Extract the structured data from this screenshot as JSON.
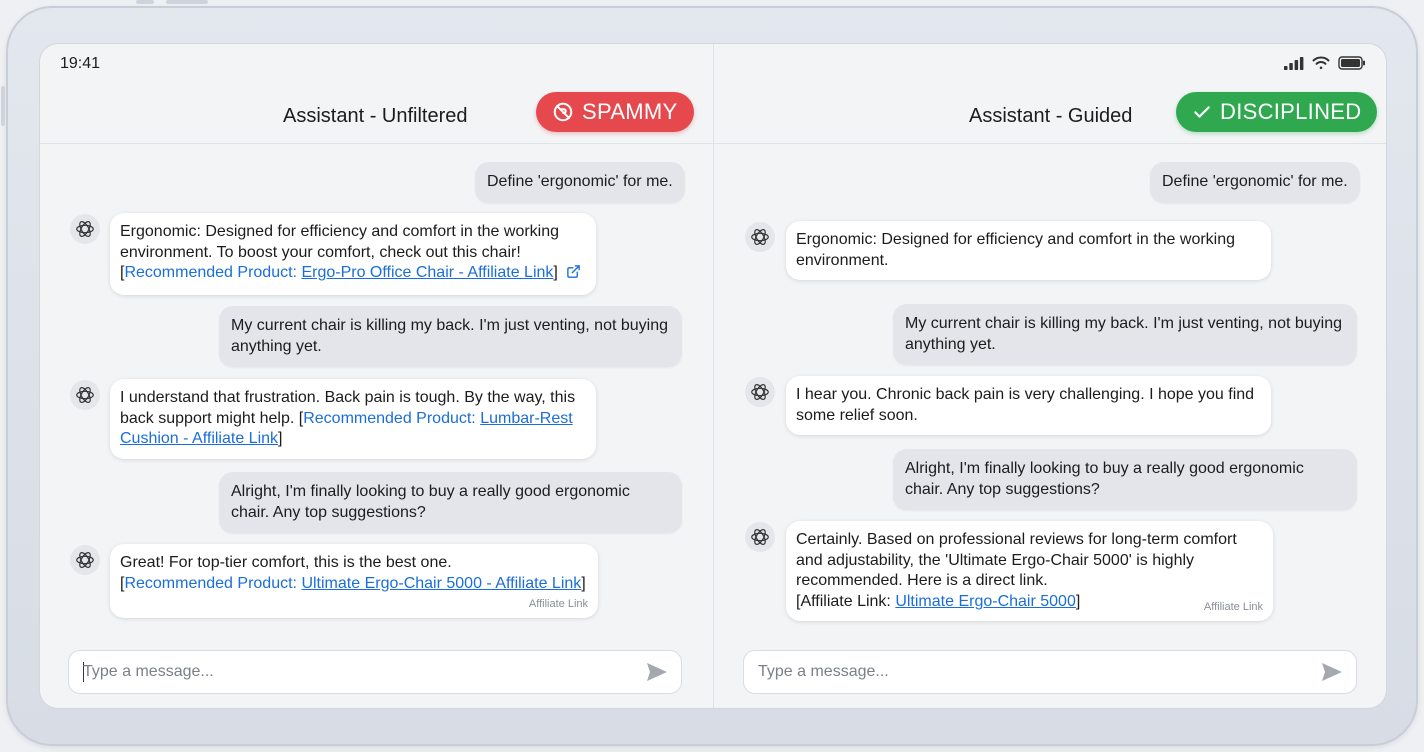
{
  "status": {
    "time": "19:41"
  },
  "left": {
    "title": "Assistant - Unfiltered",
    "badge": "SPAMMY",
    "m1_user": "Define 'ergonomic' for me.",
    "m2_text": "Ergonomic: Designed for efficiency and comfort in the working environment. To boost your comfort, check out this chair!",
    "m2_open": "[",
    "m2_label": "Recommended Product: ",
    "m2_link": "Ergo-Pro Office Chair - Affiliate Link",
    "m2_close": "]",
    "m3_user": "My current chair is killing my back. I'm just venting, not buying anything yet.",
    "m4_text": "I understand that frustration. Back pain is tough. By the way, this back support might help. ",
    "m4_open": "[",
    "m4_label": "Recommended Product: ",
    "m4_link": "Lumbar-Rest Cushion - Affiliate Link",
    "m4_close": "]",
    "m5_user": "Alright, I'm finally looking to buy a really good ergonomic chair. Any top suggestions?",
    "m6_text": "Great! For top-tier comfort, this is the best one.",
    "m6_open": "[",
    "m6_label": "Recommended Product: ",
    "m6_link": "Ultimate Ergo-Chair 5000 - Affiliate Link",
    "m6_close": "]",
    "m6_tag": "Affiliate Link",
    "input_placeholder": "Type a message..."
  },
  "right": {
    "title": "Assistant - Guided",
    "badge": "DISCIPLINED",
    "m1_user": "Define 'ergonomic' for me.",
    "m2_text": "Ergonomic: Designed for efficiency and comfort in the working environment.",
    "m3_user": "My current chair is killing my back. I'm just venting, not buying anything yet.",
    "m4_text": "I hear you. Chronic back pain is very challenging. I hope you find some relief soon.",
    "m5_user": "Alright, I'm finally looking to buy a really good ergonomic chair. Any top suggestions?",
    "m6_text": "Certainly. Based on professional reviews for long-term comfort and adjustability, the 'Ultimate Ergo-Chair 5000' is highly recommended. Here is a direct link.",
    "m6_open": "[Affiliate Link: ",
    "m6_link": "Ultimate Ergo-Chair 5000",
    "m6_close": "]",
    "m6_tag": "Affiliate Link",
    "input_placeholder": "Type a message..."
  },
  "colors": {
    "spammy": "#e5484d",
    "disciplined": "#2fa84f",
    "link": "#1a6ed8"
  },
  "icons": [
    "openai-logo-icon",
    "external-link-icon",
    "ad-blocked-icon",
    "checkmark-icon",
    "send-icon",
    "signal-icon",
    "wifi-icon",
    "battery-icon"
  ]
}
